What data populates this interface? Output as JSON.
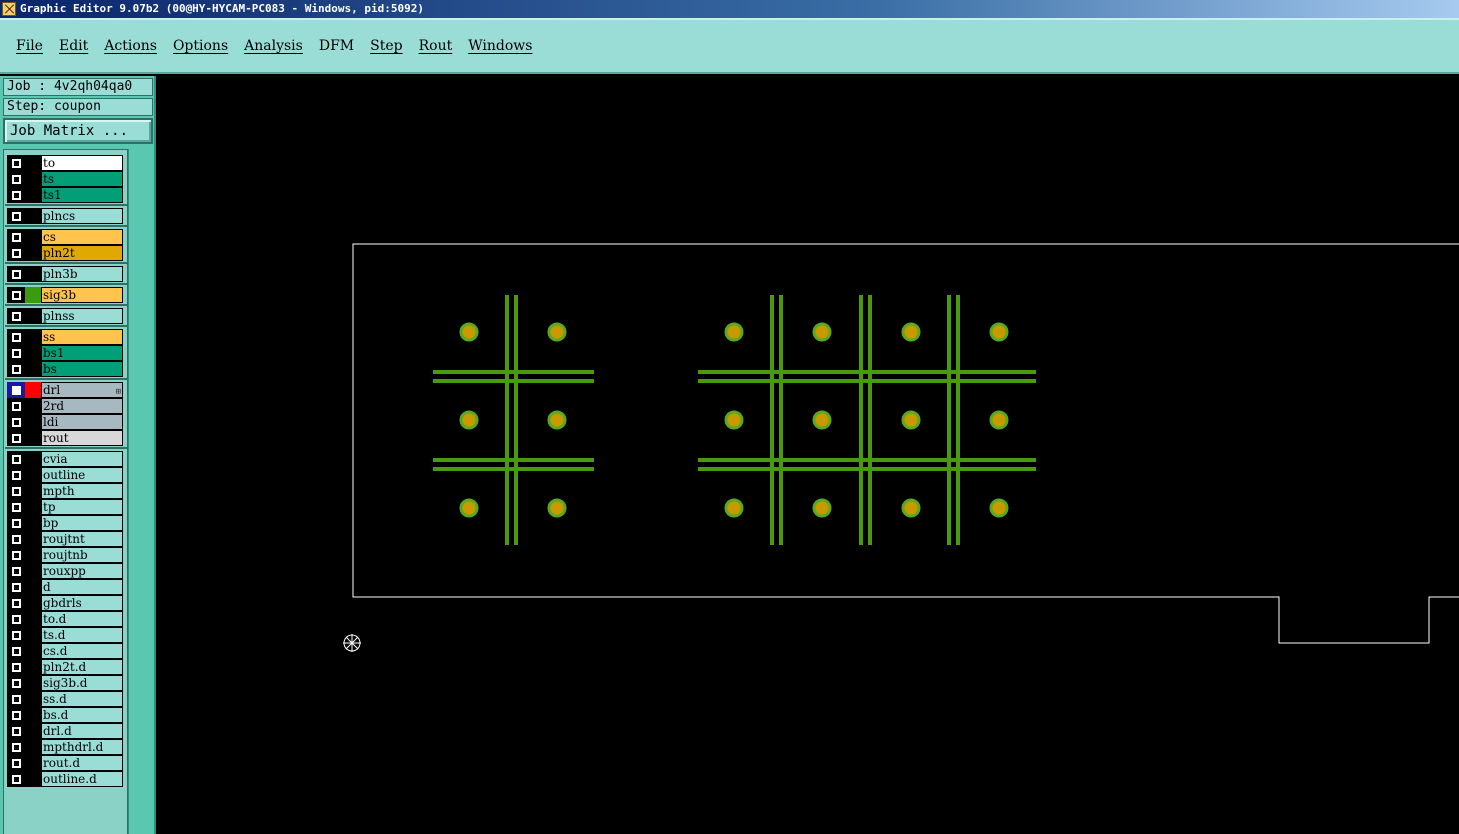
{
  "window": {
    "title": "Graphic Editor 9.07b2 (00@HY-HYCAM-PC083 - Windows, pid:5092)"
  },
  "menu": [
    {
      "label": "File"
    },
    {
      "label": "Edit"
    },
    {
      "label": "Actions"
    },
    {
      "label": "Options"
    },
    {
      "label": "Analysis"
    },
    {
      "label": "DFM"
    },
    {
      "label": "Step"
    },
    {
      "label": "Rout"
    },
    {
      "label": "Windows"
    }
  ],
  "panel": {
    "job_label": "Job : 4v2qh04qa0",
    "step_label": "Step: coupon",
    "job_matrix_button": "Job Matrix ..."
  },
  "layers": [
    {
      "name": "to",
      "color": "#ffffff"
    },
    {
      "name": "ts",
      "color": "#009f77"
    },
    {
      "name": "ts1",
      "color": "#009f77"
    },
    {
      "name": "plncs",
      "color": "#9adcd6"
    },
    {
      "name": "cs",
      "color": "#ffc44d"
    },
    {
      "name": "pln2t",
      "color": "#e0a800"
    },
    {
      "name": "pln3b",
      "color": "#9adcd6"
    },
    {
      "name": "sig3b",
      "color": "#ffc44d",
      "swatch": "#3a9a10"
    },
    {
      "name": "plnss",
      "color": "#9adcd6"
    },
    {
      "name": "ss",
      "color": "#ffc44d"
    },
    {
      "name": "bs1",
      "color": "#009f77"
    },
    {
      "name": "bs",
      "color": "#009f77"
    },
    {
      "name": "drl",
      "color": "#a8b8c0",
      "swatch": "#ff0000",
      "active": true
    },
    {
      "name": "2rd",
      "color": "#a8b8c0"
    },
    {
      "name": "ldi",
      "color": "#a8b8c0"
    },
    {
      "name": "rout",
      "color": "#d8d8d8"
    },
    {
      "name": "cvia",
      "color": "#9adcd6"
    },
    {
      "name": "outline",
      "color": "#9adcd6"
    },
    {
      "name": "mpth",
      "color": "#9adcd6"
    },
    {
      "name": "tp",
      "color": "#9adcd6"
    },
    {
      "name": "bp",
      "color": "#9adcd6"
    },
    {
      "name": "roujtnt",
      "color": "#9adcd6"
    },
    {
      "name": "roujtnb",
      "color": "#9adcd6"
    },
    {
      "name": "rouxpp",
      "color": "#9adcd6"
    },
    {
      "name": "d",
      "color": "#9adcd6"
    },
    {
      "name": "gbdrls",
      "color": "#9adcd6"
    },
    {
      "name": "to.d",
      "color": "#9adcd6"
    },
    {
      "name": "ts.d",
      "color": "#9adcd6"
    },
    {
      "name": "cs.d",
      "color": "#9adcd6"
    },
    {
      "name": "pln2t.d",
      "color": "#9adcd6"
    },
    {
      "name": "sig3b.d",
      "color": "#9adcd6"
    },
    {
      "name": "ss.d",
      "color": "#9adcd6"
    },
    {
      "name": "bs.d",
      "color": "#9adcd6"
    },
    {
      "name": "drl.d",
      "color": "#9adcd6"
    },
    {
      "name": "mpthdrl.d",
      "color": "#9adcd6"
    },
    {
      "name": "rout.d",
      "color": "#9adcd6"
    },
    {
      "name": "outline.d",
      "color": "#9adcd6"
    }
  ],
  "colors": {
    "trace": "#4a9a10",
    "pad_fill": "#c89a00",
    "pad_ring": "#5aaa20",
    "outline": "#ffffff"
  }
}
